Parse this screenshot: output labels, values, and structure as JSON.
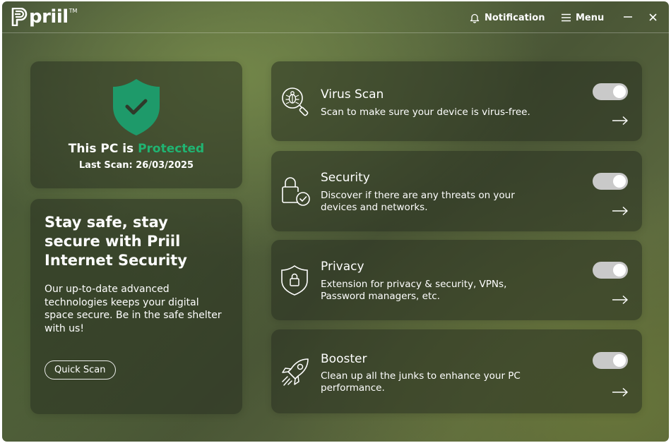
{
  "app": {
    "brand": "priil",
    "trademark": "TM"
  },
  "titlebar": {
    "notification_label": "Notification",
    "menu_label": "Menu",
    "notification_icon": "bell-icon",
    "menu_icon": "hamburger-icon",
    "minimize_icon": "minimize-icon",
    "close_icon": "close-icon"
  },
  "status": {
    "title_prefix": "This PC is",
    "title_status": "Protected",
    "last_scan": "Last Scan: 26/03/2025",
    "icon": "shield-check-icon"
  },
  "promo": {
    "headline": "Stay safe, stay\nsecure with  Priil\nInternet Security",
    "body": "Our up-to-date advanced technologies keeps your digital space secure. Be in the safe shelter with us!",
    "button_label": "Quick Scan"
  },
  "features": [
    {
      "title": "Virus Scan",
      "description": "Scan to make sure your device is virus-free.",
      "enabled": true,
      "icon": "virus-search-icon"
    },
    {
      "title": "Security",
      "description": "Discover if there are any threats on your devices and networks.",
      "enabled": true,
      "icon": "lock-check-icon"
    },
    {
      "title": "Privacy",
      "description": "Extension for privacy & security, VPNs, Password managers, etc.",
      "enabled": true,
      "icon": "shield-lock-icon"
    },
    {
      "title": "Booster",
      "description": "Clean up all the junks to enhance  your PC performance.",
      "enabled": true,
      "icon": "rocket-icon"
    }
  ],
  "colors": {
    "accent_green": "#20b472",
    "shield_green": "#1e9a6a",
    "toggle_track": "#c9c9c9",
    "text": "#ffffff"
  }
}
